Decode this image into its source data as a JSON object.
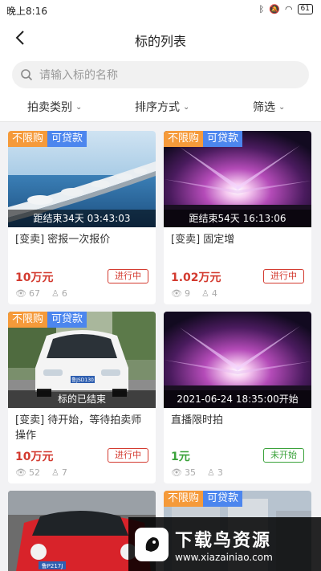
{
  "statusbar": {
    "time": "晚上8:16",
    "battery": "61"
  },
  "nav": {
    "title": "标的列表"
  },
  "search": {
    "placeholder": "请输入标的名称"
  },
  "filters": {
    "category": "拍卖类别",
    "sort": "排序方式",
    "filter": "筛选"
  },
  "tags": {
    "unlimited": "不限购",
    "loan": "可贷款"
  },
  "cards": [
    {
      "countdown": "距结束34天 03:43:03",
      "title": "[变卖] 密报一次报价",
      "price": "10万元",
      "status": "进行中",
      "views": "67",
      "bids": "6"
    },
    {
      "countdown": "距结束54天 16:13:06",
      "title": "[变卖] 固定增",
      "price": "1.02万元",
      "status": "进行中",
      "views": "9",
      "bids": "4"
    },
    {
      "countdown": "标的已结束",
      "title": "[变卖] 待开始，等待拍卖师操作",
      "price": "10万元",
      "status": "进行中",
      "views": "52",
      "bids": "7",
      "plate": "鲁JSD130"
    },
    {
      "countdown": "2021-06-24 18:35:00开始",
      "title": "直播限时拍",
      "price": "1元",
      "status": "未开始",
      "views": "35",
      "bids": "3"
    },
    {
      "plate": "鲁P217J"
    }
  ],
  "watermark": {
    "title": "下载鸟资源",
    "url": "www.xiazainiao.com"
  },
  "colors": {
    "red": "#d33a2f",
    "green": "#3aa23a",
    "orange_tag": "#f59a3a",
    "blue_tag": "#4c86ee"
  }
}
